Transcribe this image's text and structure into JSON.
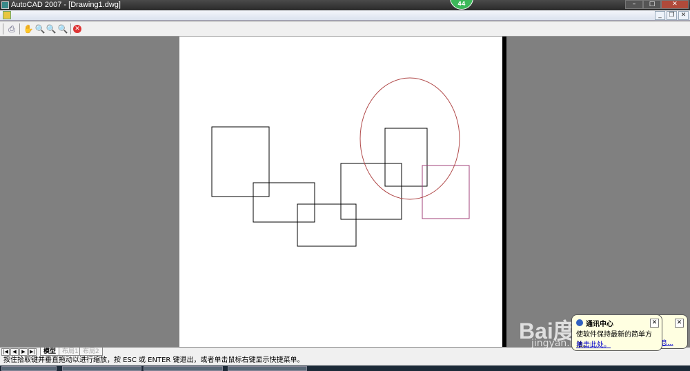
{
  "window": {
    "title": "AutoCAD 2007 - [Drawing1.dwg]",
    "badge": "44"
  },
  "toolbar": {
    "icons": [
      "print-icon",
      "pan-icon",
      "zoom-realtime-icon",
      "zoom-icon",
      "zoom-previous-icon",
      "close-icon"
    ]
  },
  "layout_tabs": [
    {
      "label": "模型",
      "active": true
    },
    {
      "label": "布局1",
      "active": false
    },
    {
      "label": "布局2",
      "active": false
    }
  ],
  "status": {
    "text": "按住拾取键并垂直拖动以进行缩放，按 ESC 或 ENTER 键退出，或者单击鼠标右键显示快捷菜单。"
  },
  "balloon": {
    "title": "通讯中心",
    "body": "使软件保持最新的简单方法。",
    "link": "单击此处。",
    "back_link": "息..."
  },
  "watermark": {
    "text": "Bai度经验",
    "url": "jingyan.baidu.com"
  },
  "colors": {
    "ellipse": "#b04848",
    "purple_rect": "#a0407a",
    "lines": "#000000"
  }
}
